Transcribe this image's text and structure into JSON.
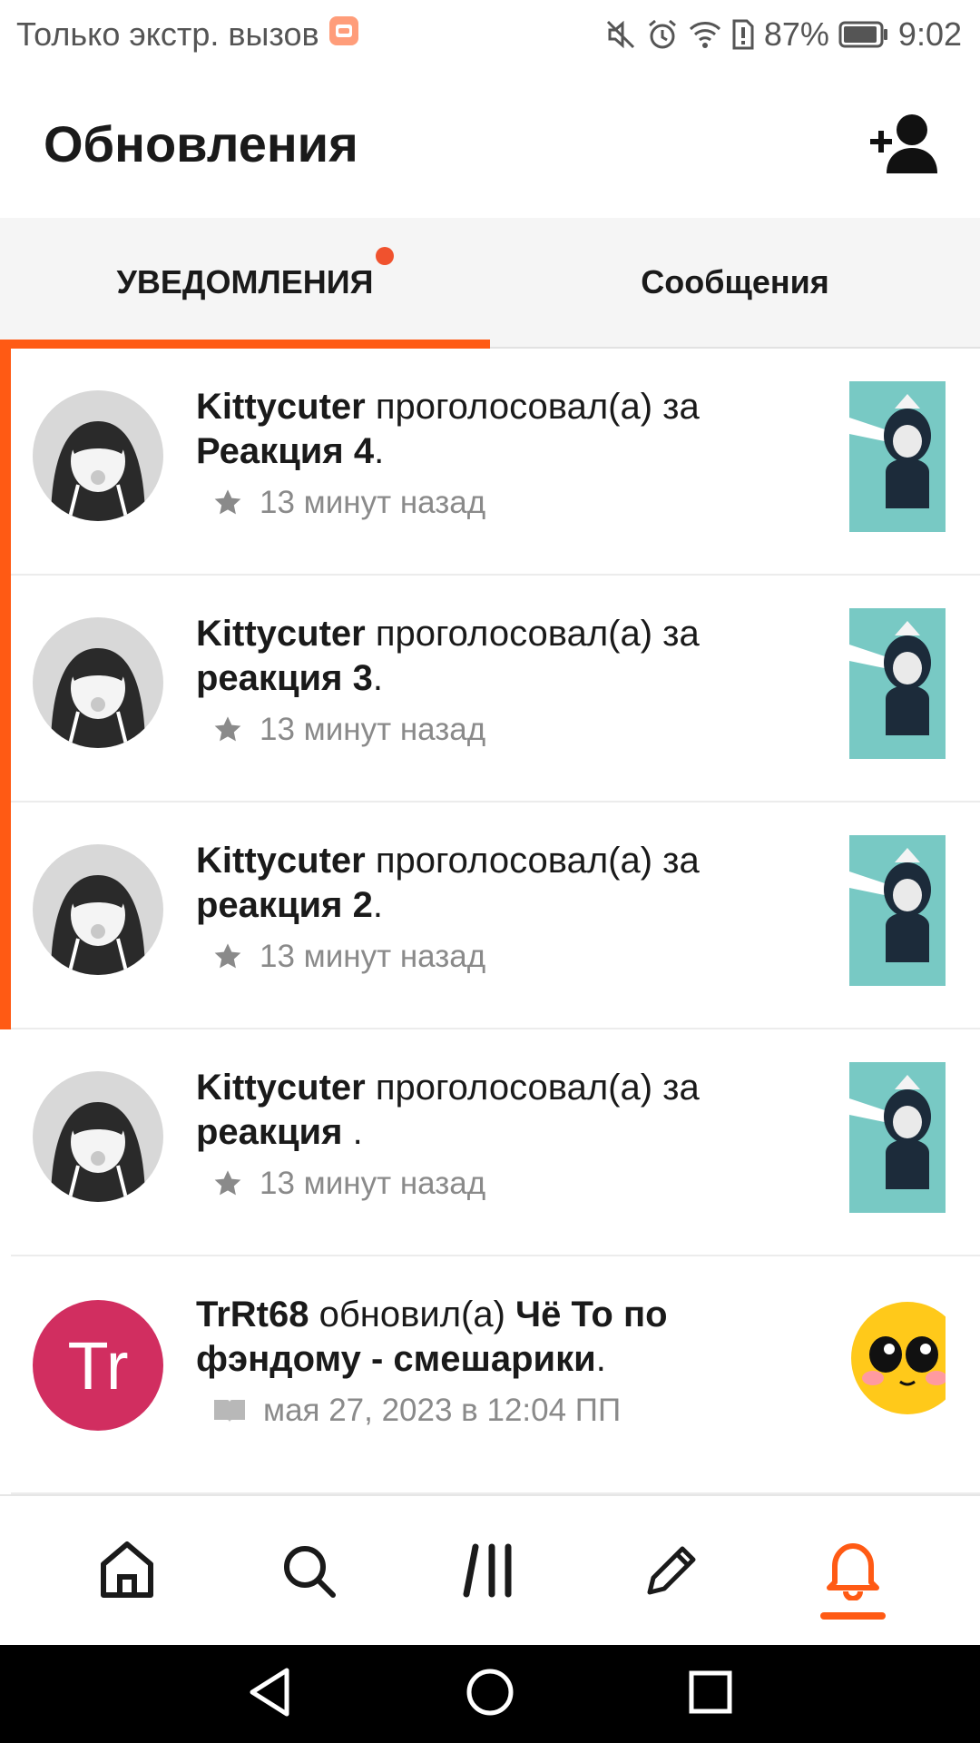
{
  "status_bar": {
    "carrier_text": "Только экстр. вызов",
    "battery_percent": "87%",
    "time": "9:02"
  },
  "header": {
    "title": "Обновления"
  },
  "tabs": [
    {
      "label": "УВЕДОМЛЕНИЯ",
      "active": true,
      "has_dot": true
    },
    {
      "label": "Сообщения",
      "active": false,
      "has_dot": false
    }
  ],
  "notifications": [
    {
      "user": "Kittycuter",
      "action": " проголосовал(а) за ",
      "target": "Реакция 4",
      "suffix": ".",
      "time": "13 минут назад",
      "icon": "star-icon",
      "unread": true
    },
    {
      "user": "Kittycuter",
      "action": " проголосовал(а) за ",
      "target": "реакция 3",
      "suffix": ".",
      "time": "13 минут назад",
      "icon": "star-icon",
      "unread": true
    },
    {
      "user": "Kittycuter",
      "action": " проголосовал(а) за ",
      "target": "реакция 2",
      "suffix": ".",
      "time": "13 минут назад",
      "icon": "star-icon",
      "unread": true
    },
    {
      "user": "Kittycuter",
      "action": " проголосовал(а) за ",
      "target": "реакция ",
      "suffix": ".",
      "time": "13 минут назад",
      "icon": "star-icon",
      "unread": false
    },
    {
      "user": "TrRt68",
      "action": " обновил(а) ",
      "target": "Чё То по фэндому - смешарики",
      "suffix": ".",
      "time": "мая 27, 2023 в 12:04 ПП",
      "icon": "book-icon",
      "unread": false,
      "avatar_initials": "Tr"
    }
  ],
  "colors": {
    "accent": "#ff5a14",
    "dot": "#f0522e",
    "initials_avatar": "#d12e60",
    "thumb_bg": "#78c9c4"
  },
  "bottom_nav": [
    {
      "name": "home-icon",
      "active": false
    },
    {
      "name": "search-icon",
      "active": false
    },
    {
      "name": "library-icon",
      "active": false
    },
    {
      "name": "pencil-icon",
      "active": false
    },
    {
      "name": "bell-icon",
      "active": true
    }
  ]
}
